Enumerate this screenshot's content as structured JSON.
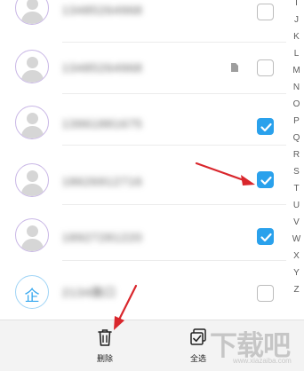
{
  "contacts": [
    {
      "name": "13485264968",
      "avatar": "person",
      "checked": false,
      "file_icon": false
    },
    {
      "name": "13485264968",
      "avatar": "person",
      "checked": false,
      "file_icon": true
    },
    {
      "name": "13961881675",
      "avatar": "person",
      "checked": true,
      "file_icon": false
    },
    {
      "name": "18626912716",
      "avatar": "person",
      "checked": true,
      "file_icon": false
    },
    {
      "name": "18927281220",
      "avatar": "person",
      "checked": true,
      "file_icon": false
    },
    {
      "name": "2134路口",
      "avatar": "company",
      "avatar_glyph": "企",
      "checked": false,
      "file_icon": false
    }
  ],
  "alphabet_index": [
    "I",
    "J",
    "K",
    "L",
    "M",
    "N",
    "O",
    "P",
    "Q",
    "R",
    "S",
    "T",
    "U",
    "V",
    "W",
    "X",
    "Y",
    "Z"
  ],
  "toolbar": {
    "delete_label": "删除",
    "select_all_label": "全选"
  },
  "watermark": {
    "text": "下载吧",
    "url": "www.xiazaiba.com"
  },
  "colors": {
    "check_blue": "#2aa1ec",
    "arrow_red": "#d9262c",
    "avatar_border": "#c9b7e6"
  }
}
